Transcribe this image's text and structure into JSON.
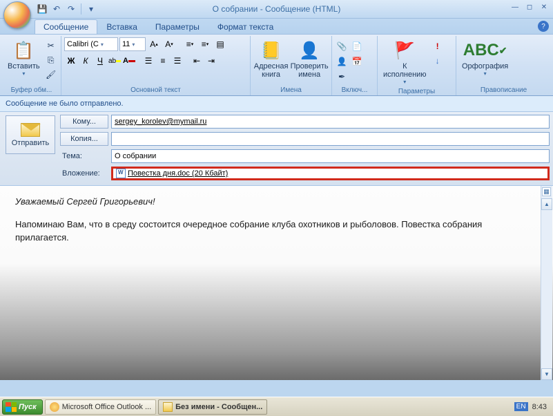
{
  "window": {
    "title": "О собрании - Сообщение (HTML)"
  },
  "qat": {
    "save": "💾",
    "undo": "↶",
    "redo": "↷",
    "dropdown": "▾"
  },
  "tabs": {
    "message": "Сообщение",
    "insert": "Вставка",
    "options": "Параметры",
    "format": "Формат текста"
  },
  "ribbon": {
    "clipboard": {
      "paste": "Вставить",
      "label": "Буфер обм..."
    },
    "basic_text": {
      "font_name": "Calibri (С",
      "font_size": "11",
      "label": "Основной текст"
    },
    "names": {
      "address_book": "Адресная\nкнига",
      "check_names": "Проверить\nимена",
      "label": "Имена"
    },
    "include": {
      "label": "Включ..."
    },
    "followup": {
      "label_btn": "К\nисполнению",
      "label": "Параметры"
    },
    "proofing": {
      "spelling": "Орфография",
      "label": "Правописание"
    }
  },
  "info_bar": "Сообщение не было отправлено.",
  "fields": {
    "send": "Отправить",
    "to_btn": "Кому...",
    "to_value": "sergey_korolev@mymail.ru",
    "cc_btn": "Копия...",
    "cc_value": "",
    "subject_label": "Тема:",
    "subject_value": "О собрании",
    "attach_label": "Вложение:",
    "attach_name": "Повестка дня.doc (20 Кбайт)"
  },
  "body": {
    "greeting": "Уважаемый Сергей Григорьевич!",
    "para1": "Напоминаю  Вам, что в среду состоится очередное собрание клуба охотников и рыболовов. Повестка собрания прилагается."
  },
  "taskbar": {
    "start": "Пуск",
    "task1": "Microsoft Office Outlook ...",
    "task2": "Без имени - Сообщен...",
    "lang": "EN",
    "clock": "8:43"
  }
}
